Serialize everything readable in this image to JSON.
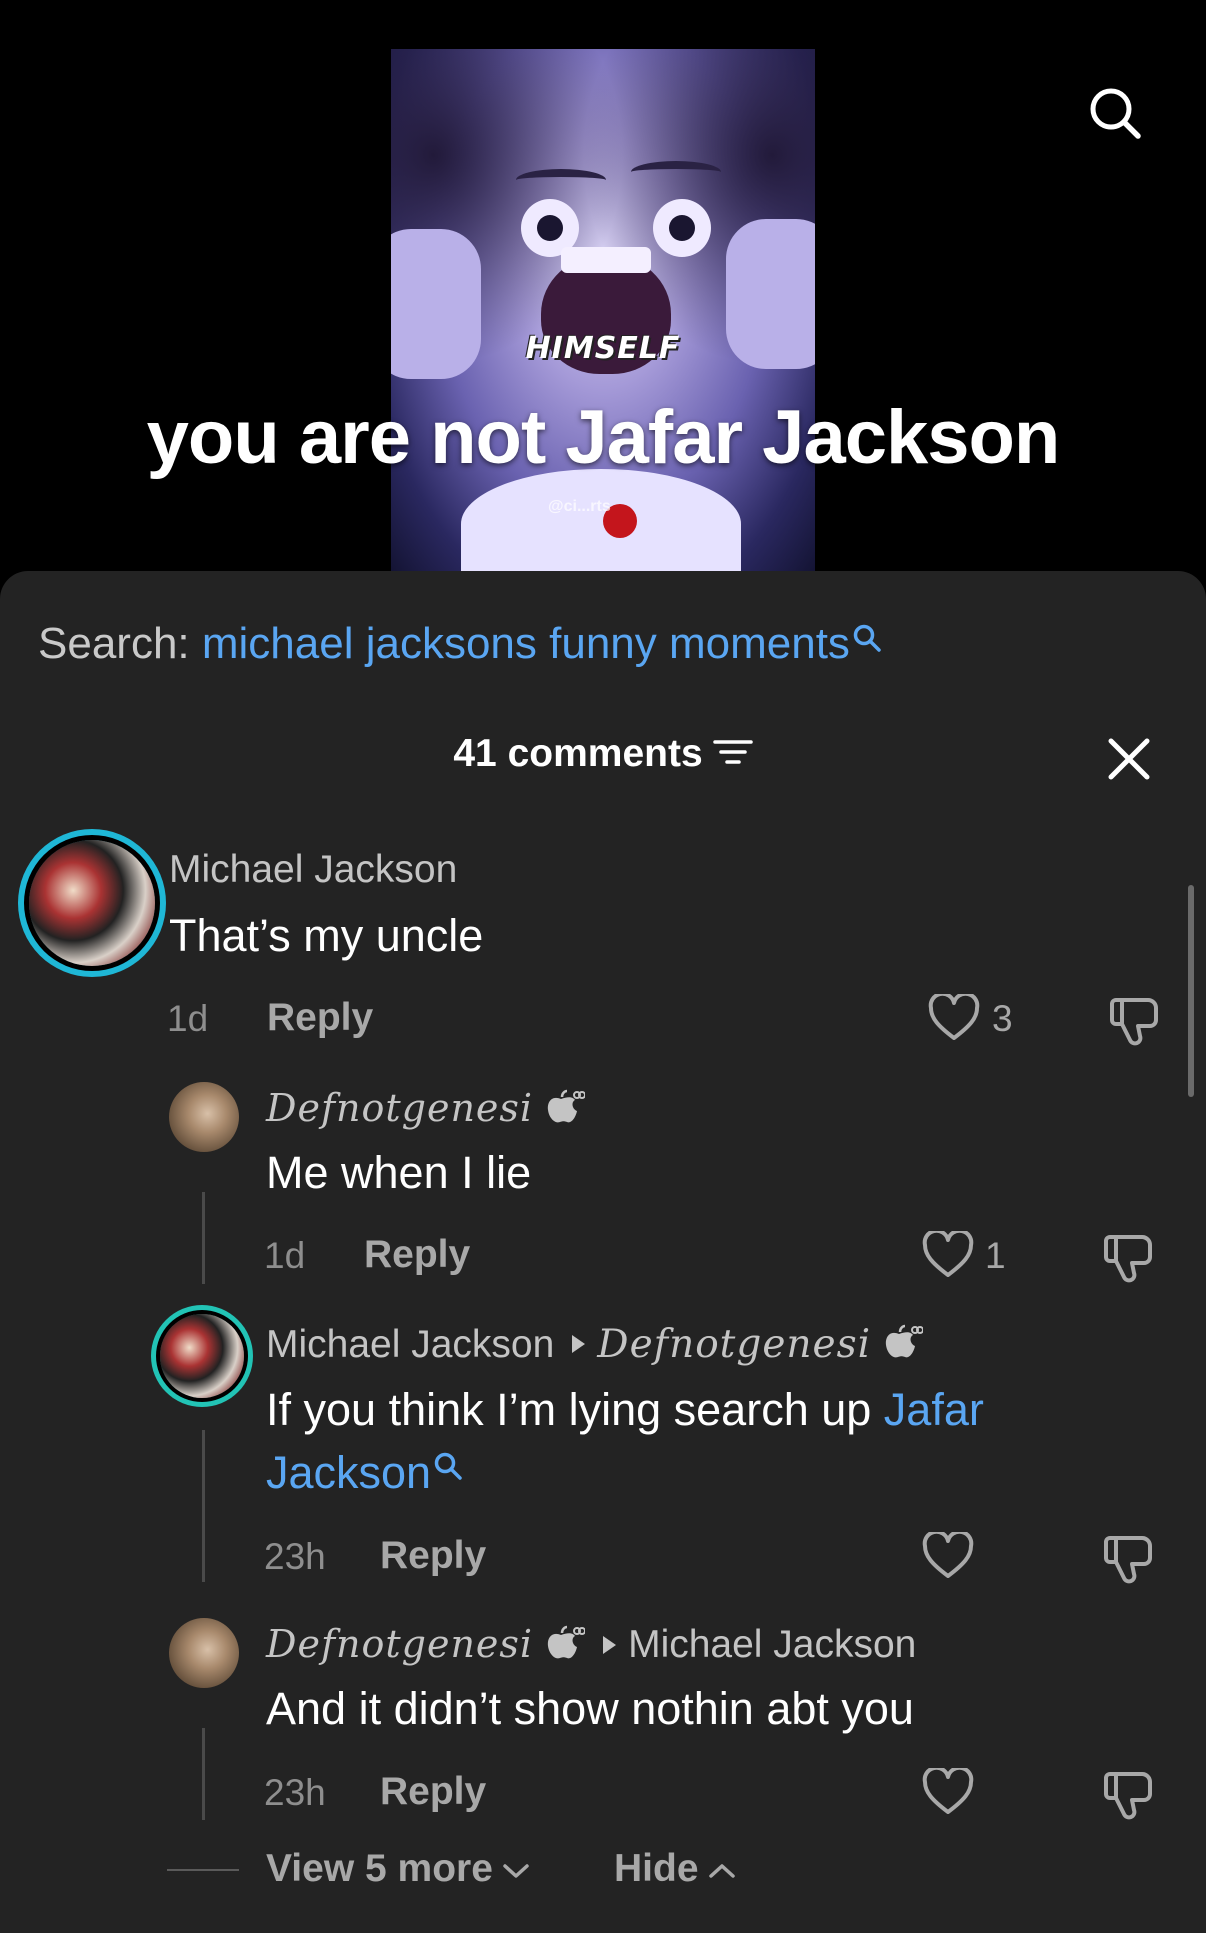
{
  "video": {
    "overlay_label": "HIMSELF",
    "caption": "you are not Jafar Jackson",
    "watermark": "@ci...rts"
  },
  "search_suggestion": {
    "prefix": "Search: ",
    "query": "michael jacksons funny moments"
  },
  "comments_header": {
    "count_label": "41 comments"
  },
  "comments": [
    {
      "user": "Michael Jackson",
      "text": "That’s my uncle",
      "time": "1d",
      "reply_label": "Reply",
      "likes": "3"
    },
    {
      "user": "Defnotgenesi",
      "text": "Me when I lie",
      "time": "1d",
      "reply_label": "Reply",
      "likes": "1"
    },
    {
      "user": "Michael Jackson",
      "reply_to": "Defnotgenesi",
      "text_plain": "If you think I’m lying search up ",
      "text_link_1": "Jafar",
      "text_link_2": "Jackson",
      "time": "23h",
      "reply_label": "Reply"
    },
    {
      "user": "Defnotgenesi",
      "reply_to": "Michael Jackson",
      "text": "And it didn’t show nothin abt you",
      "time": "23h",
      "reply_label": "Reply"
    }
  ],
  "thread_controls": {
    "view_more": "View 5 more",
    "hide": "Hide"
  },
  "icons": {
    "search": "search-icon",
    "sort": "sort-icon",
    "close": "close-icon",
    "like": "heart-icon",
    "dislike": "thumbs-down-icon"
  },
  "colors": {
    "sheet_bg": "#232323",
    "link_blue": "#5aa6f2",
    "ring_cyan": "#1fb7d6"
  }
}
